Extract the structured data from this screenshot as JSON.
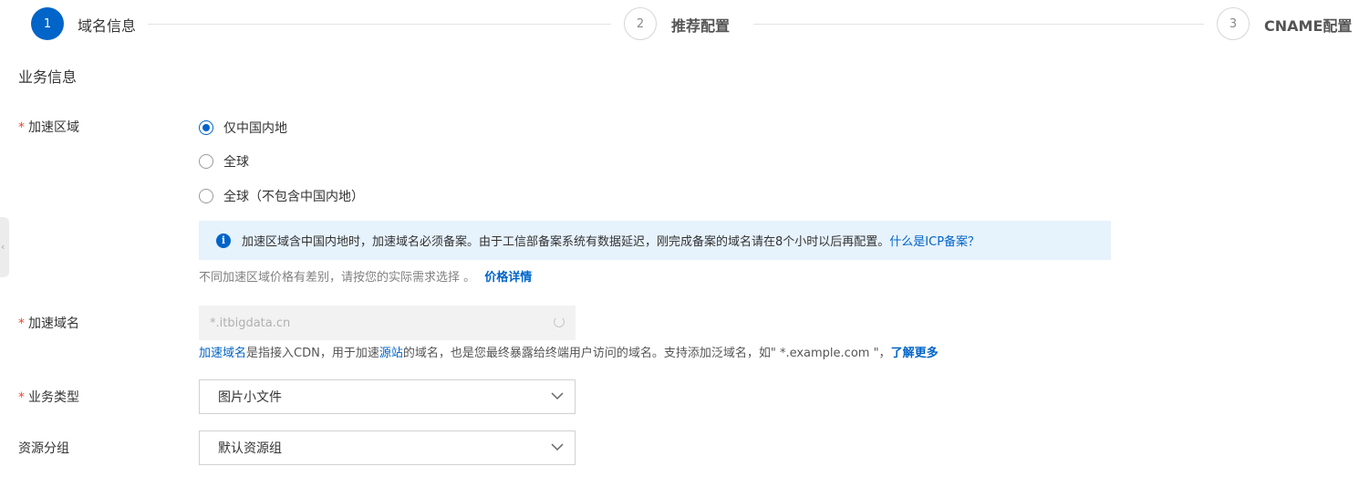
{
  "steps": [
    {
      "number": "1",
      "label": "域名信息",
      "state": "active"
    },
    {
      "number": "2",
      "label": "推荐配置",
      "state": "inactive"
    },
    {
      "number": "3",
      "label": "CNAME配置",
      "state": "inactive"
    }
  ],
  "section_title": "业务信息",
  "accel_region": {
    "required_mark": "*",
    "label": "加速区域",
    "options": [
      {
        "label": "仅中国内地",
        "checked": true
      },
      {
        "label": "全球",
        "checked": false
      },
      {
        "label": "全球（不包含中国内地）",
        "checked": false
      }
    ],
    "info_text": "加速区域含中国内地时，加速域名必须备案。由于工信部备案系统有数据延迟，刚完成备案的域名请在8个小时以后再配置。",
    "info_link": "什么是ICP备案？",
    "price_hint": "不同加速区域价格有差别，请按您的实际需求选择 。",
    "price_link": "价格详情"
  },
  "accel_domain": {
    "required_mark": "*",
    "label": "加速域名",
    "value": "*.itbigdata.cn",
    "hint_link1": "加速域名",
    "hint_text1": "是指接入CDN，用于加速",
    "hint_link2": "源站",
    "hint_text2": "的域名，也是您最终暴露给终端用户访问的域名。支持添加泛域名，如\" *.example.com \"，",
    "hint_link3": "了解更多"
  },
  "business_type": {
    "required_mark": "*",
    "label": "业务类型",
    "selected": "图片小文件"
  },
  "resource_group": {
    "label": "资源分组",
    "selected": "默认资源组"
  },
  "side_handle_glyph": "‹",
  "colors": {
    "primary": "#0064c8",
    "required": "#e84738",
    "info_bg": "#e6f2fc"
  }
}
